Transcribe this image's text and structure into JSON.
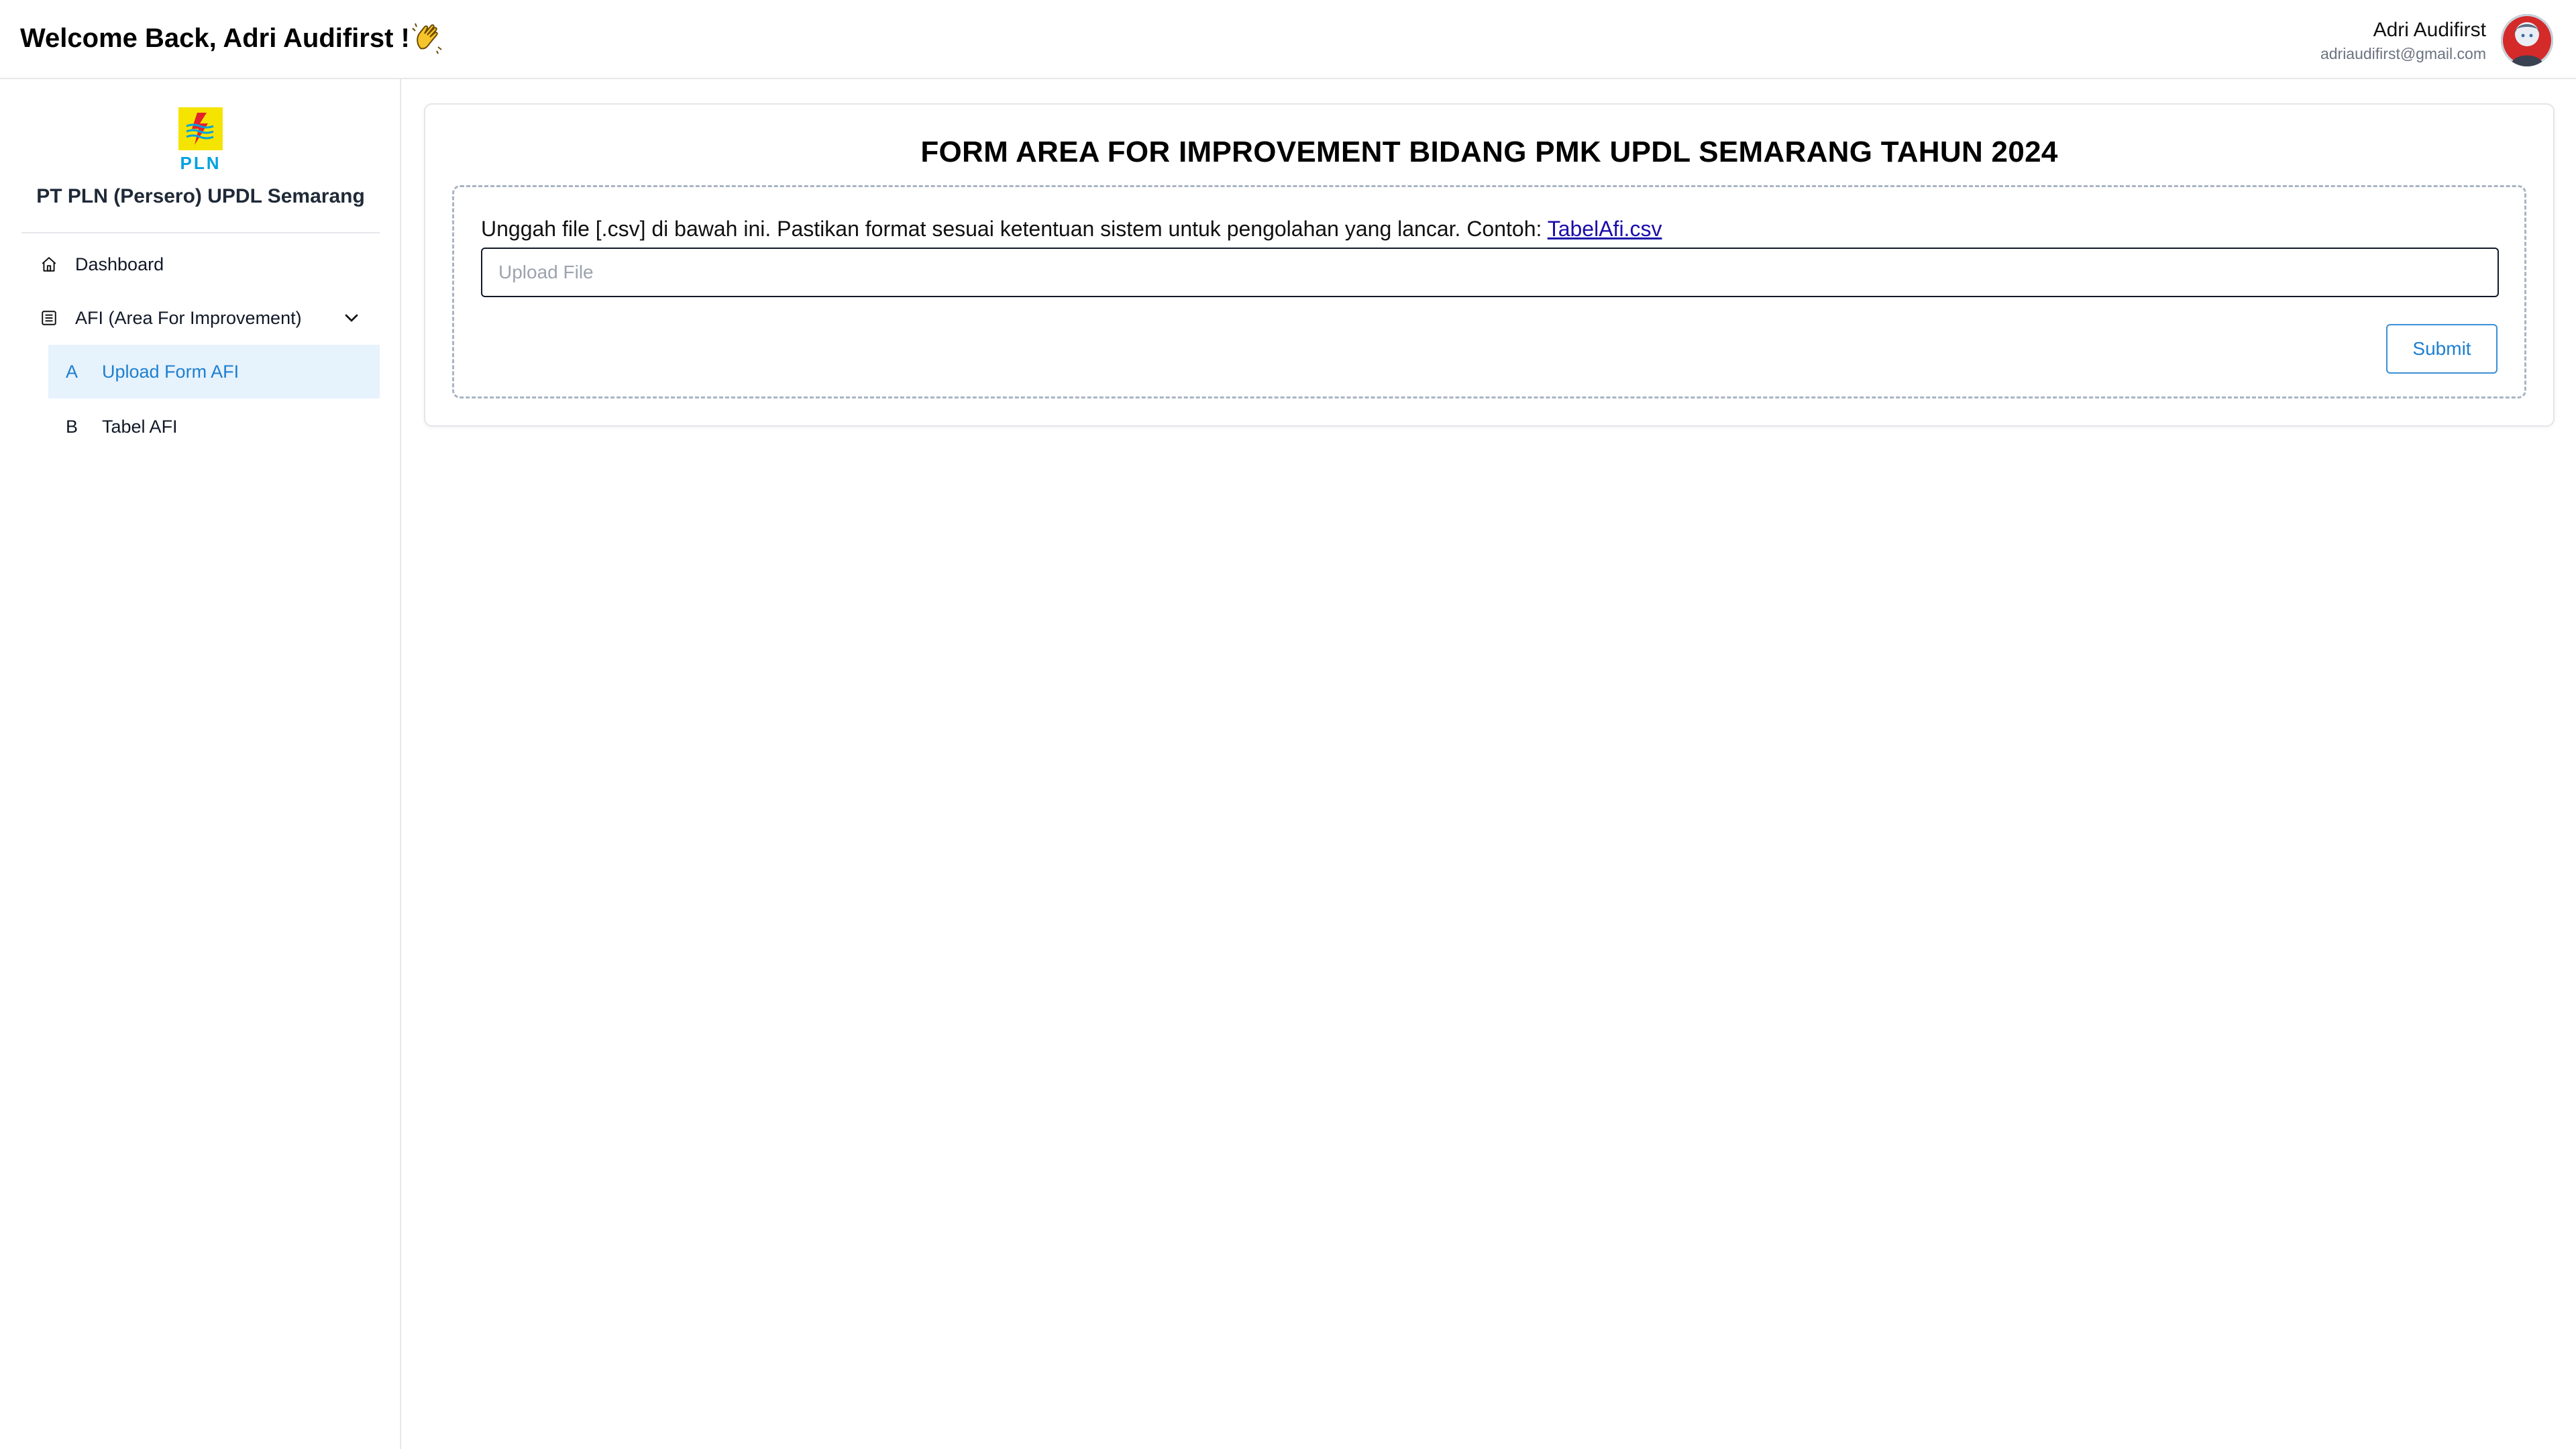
{
  "header": {
    "welcome": "Welcome Back, Adri Audifirst !",
    "wave_icon": "clapping-hand-icon",
    "user_name": "Adri Audifirst",
    "user_email": "adriaudifirst@gmail.com"
  },
  "sidebar": {
    "logo_text": "PLN",
    "company": "PT PLN (Persero) UPDL Semarang",
    "items": [
      {
        "label": "Dashboard",
        "icon": "home-icon"
      },
      {
        "label": "AFI (Area For Improvement)",
        "icon": "list-icon",
        "expanded": true
      }
    ],
    "sub_items": [
      {
        "letter": "A",
        "label": "Upload Form AFI",
        "active": true
      },
      {
        "letter": "B",
        "label": "Tabel AFI",
        "active": false
      }
    ]
  },
  "main": {
    "title": "FORM AREA FOR IMPROVEMENT BIDANG PMK UPDL SEMARANG TAHUN 2024",
    "instruction": "Unggah file [.csv] di bawah ini. Pastikan format sesuai ketentuan sistem untuk pengolahan yang lancar. Contoh: ",
    "example_link": "TabelAfi.csv",
    "upload_placeholder": "Upload File",
    "submit_label": "Submit"
  },
  "colors": {
    "accent": "#1d7fcf",
    "active_bg": "#e6f2fc",
    "logo_yellow": "#f5e300",
    "logo_blue": "#00a2e0"
  }
}
